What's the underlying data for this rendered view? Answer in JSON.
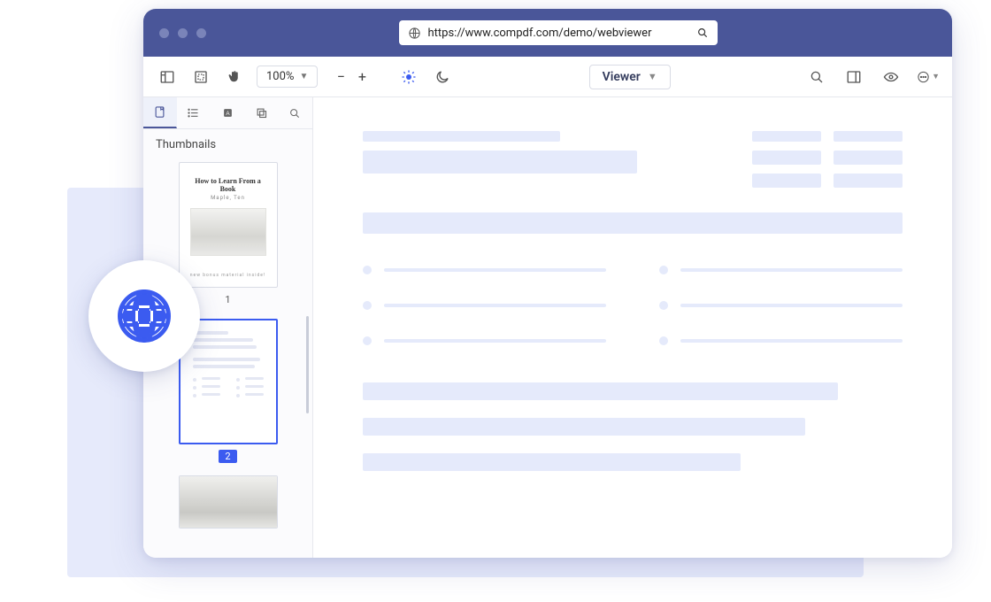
{
  "addressbar": {
    "url": "https://www.compdf.com/demo/webviewer"
  },
  "toolbar": {
    "zoom": "100%"
  },
  "mode": {
    "label": "Viewer"
  },
  "sidebar": {
    "title": "Thumbnails"
  },
  "thumbs": {
    "page1": {
      "title": "How to Learn From a Book",
      "subtitle": "Maple, Ten",
      "footer": "new bonus material inside!",
      "label": "1"
    },
    "page2": {
      "label": "2"
    }
  }
}
